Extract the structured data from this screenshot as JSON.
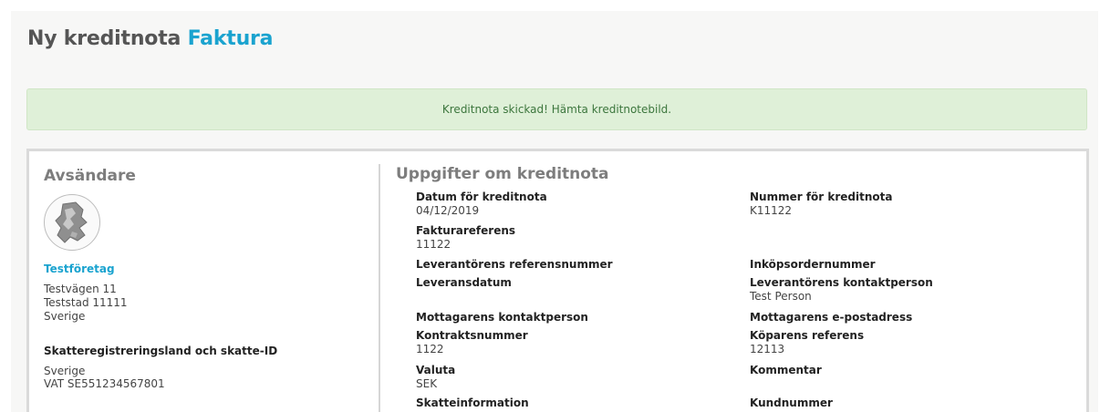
{
  "header": {
    "title_prefix": "Ny kreditnota",
    "title_accent": "Faktura"
  },
  "alert": {
    "message": "Kreditnota skickad! Hämta kreditnotebild."
  },
  "sender": {
    "heading": "Avsändare",
    "company": "Testföretag",
    "address_line1": "Testvägen 11",
    "address_line2": "Teststad 11111",
    "country": "Sverige",
    "tax_heading": "Skatteregistreringsland och skatte-ID",
    "tax_country": "Sverige",
    "tax_id": "VAT SE551234567801"
  },
  "details": {
    "heading": "Uppgifter om kreditnota",
    "fields": [
      {
        "label": "Datum för kreditnota",
        "value": "04/12/2019"
      },
      {
        "label": "Nummer för kreditnota",
        "value": "K11122"
      },
      {
        "label": "Fakturareferens",
        "value": "11122"
      },
      {
        "label": "Leverantörens referensnummer",
        "value": ""
      },
      {
        "label": "Inköpsordernummer",
        "value": ""
      },
      {
        "label": "Leveransdatum",
        "value": ""
      },
      {
        "label": "Leverantörens kontaktperson",
        "value": "Test Person"
      },
      {
        "label": "Mottagarens kontaktperson",
        "value": ""
      },
      {
        "label": "Mottagarens e-postadress",
        "value": ""
      },
      {
        "label": "Kontraktsnummer",
        "value": "1122"
      },
      {
        "label": "Köparens referens",
        "value": "12113"
      },
      {
        "label": "Valuta",
        "value": "SEK"
      },
      {
        "label": "Kommentar",
        "value": ""
      },
      {
        "label": "Skatteinformation",
        "value": ""
      },
      {
        "label": "Kundnummer",
        "value": ""
      }
    ]
  }
}
